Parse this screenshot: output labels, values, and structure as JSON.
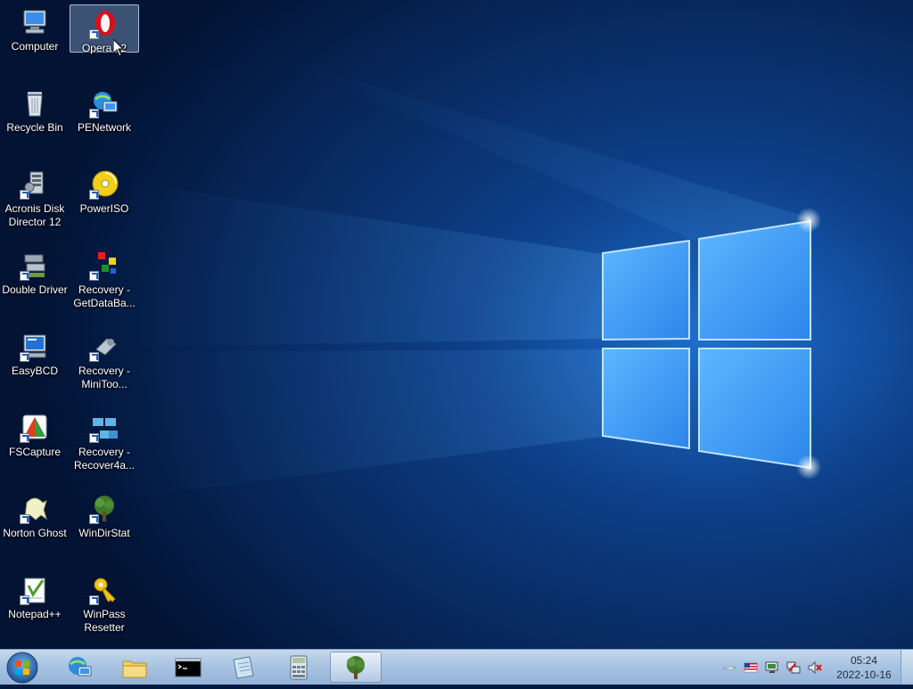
{
  "desktop": {
    "icons": [
      {
        "label": "Computer",
        "icon": "computer-icon"
      },
      {
        "label": "Opera 12",
        "icon": "opera-icon",
        "selected": true
      },
      {
        "label": "Recycle Bin",
        "icon": "recycle-bin-icon"
      },
      {
        "label": "PENetwork",
        "icon": "penetwork-icon"
      },
      {
        "label": "Acronis Disk\nDirector 12",
        "icon": "acronis-icon"
      },
      {
        "label": "PowerISO",
        "icon": "poweriso-icon"
      },
      {
        "label": "Double Driver",
        "icon": "double-driver-icon"
      },
      {
        "label": "Recovery -\nGetDataBa...",
        "icon": "getdataback-icon"
      },
      {
        "label": "EasyBCD",
        "icon": "easybcd-icon"
      },
      {
        "label": "Recovery -\nMiniToo...",
        "icon": "minitool-icon"
      },
      {
        "label": "FSCapture",
        "icon": "fscapture-icon"
      },
      {
        "label": "Recovery -\nRecover4a...",
        "icon": "recover4all-icon"
      },
      {
        "label": "Norton Ghost",
        "icon": "norton-ghost-icon"
      },
      {
        "label": "WinDirStat",
        "icon": "windirstat-icon"
      },
      {
        "label": "Notepad++",
        "icon": "notepadpp-icon"
      },
      {
        "label": "WinPass\nResetter",
        "icon": "winpass-icon"
      }
    ]
  },
  "taskbar": {
    "start_icon": "windows-orb-icon",
    "buttons": [
      {
        "icon": "network-globe-icon"
      },
      {
        "icon": "explorer-folder-icon"
      },
      {
        "icon": "command-prompt-icon"
      },
      {
        "icon": "notepad-icon"
      },
      {
        "icon": "calculator-icon"
      },
      {
        "icon": "windirstat-tree-icon",
        "active": true
      }
    ],
    "tray": {
      "icons": [
        "usb-icon",
        "us-flag-icon",
        "monitor-icon",
        "network-icon",
        "volume-muted-icon"
      ]
    },
    "clock": {
      "time": "05:24",
      "date": "2022-10-16"
    }
  },
  "colors": {
    "wallpaper_dark": "#021a3f",
    "wallpaper_light": "#4aa8ff",
    "taskbar": "#a9c4e2"
  }
}
